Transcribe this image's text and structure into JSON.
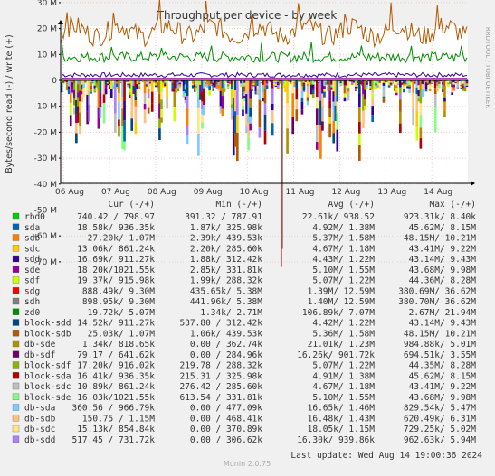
{
  "chart_data": {
    "type": "area",
    "title": "Throughput per device - by week",
    "ylabel": "Bytes/second read (-) / write (+)",
    "side_label": "RRDTOOL / TOBI OETIKER",
    "y_ticks": [
      "40 M",
      "30 M",
      "20 M",
      "10 M",
      "0",
      "-10 M",
      "-20 M",
      "-30 M",
      "-40 M",
      "-50 M",
      "-60 M",
      "-70 M"
    ],
    "y_tick_values": [
      40,
      30,
      20,
      10,
      0,
      -10,
      -20,
      -30,
      -40,
      -50,
      -60,
      -70
    ],
    "ylim": [
      -75,
      42
    ],
    "x_ticks": [
      "06 Aug",
      "07 Aug",
      "08 Aug",
      "09 Aug",
      "10 Aug",
      "11 Aug",
      "12 Aug",
      "13 Aug",
      "14 Aug"
    ],
    "grid": true,
    "columns": [
      "Cur (-/+)",
      "Min (-/+)",
      "Avg (-/+)",
      "Max (-/+)"
    ],
    "series": [
      {
        "name": "rbd0",
        "color": "#00cc00",
        "cur": "740.42 / 798.97",
        "min": "391.32 / 787.91",
        "avg": "22.61k/ 938.52",
        "max": "923.31k/   8.40k"
      },
      {
        "name": "sda",
        "color": "#0066b3",
        "cur": "18.58k/ 936.35k",
        "min": "1.87k/ 325.98k",
        "avg": "4.92M/   1.38M",
        "max": "45.62M/   8.15M"
      },
      {
        "name": "sdb",
        "color": "#ff8000",
        "cur": "27.20k/   1.07M",
        "min": "2.39k/ 439.53k",
        "avg": "5.37M/   1.58M",
        "max": "48.15M/  10.21M"
      },
      {
        "name": "sdc",
        "color": "#ffcc00",
        "cur": "13.06k/ 861.24k",
        "min": "2.20k/ 285.60k",
        "avg": "4.67M/   1.18M",
        "max": "43.41M/   9.22M"
      },
      {
        "name": "sdd",
        "color": "#330099",
        "cur": "16.69k/ 911.27k",
        "min": "1.88k/ 312.42k",
        "avg": "4.43M/   1.22M",
        "max": "43.14M/   9.43M"
      },
      {
        "name": "sde",
        "color": "#990099",
        "cur": "18.20k/1021.55k",
        "min": "2.85k/ 331.81k",
        "avg": "5.10M/   1.55M",
        "max": "43.68M/   9.98M"
      },
      {
        "name": "sdf",
        "color": "#ccff00",
        "cur": "19.37k/ 915.98k",
        "min": "1.99k/ 288.32k",
        "avg": "5.07M/   1.22M",
        "max": "44.36M/   8.28M"
      },
      {
        "name": "sdg",
        "color": "#ff0000",
        "cur": "888.49k/   9.30M",
        "min": "435.65k/   5.38M",
        "avg": "1.39M/  12.59M",
        "max": "380.69M/  36.62M"
      },
      {
        "name": "sdh",
        "color": "#808080",
        "cur": "898.95k/   9.30M",
        "min": "441.96k/   5.38M",
        "avg": "1.40M/  12.59M",
        "max": "380.70M/  36.62M"
      },
      {
        "name": "zd0",
        "color": "#008f00",
        "cur": "19.72k/   5.07M",
        "min": "1.34k/   2.71M",
        "avg": "106.89k/   7.07M",
        "max": "2.67M/  21.94M"
      },
      {
        "name": "block-sdd",
        "color": "#00487d",
        "cur": "14.52k/ 911.27k",
        "min": "537.80 / 312.42k",
        "avg": "4.42M/   1.22M",
        "max": "43.14M/   9.43M"
      },
      {
        "name": "block-sdb",
        "color": "#b35a00",
        "cur": "25.03k/   1.07M",
        "min": "1.06k/ 439.53k",
        "avg": "5.36M/   1.58M",
        "max": "48.15M/  10.21M"
      },
      {
        "name": "db-sde",
        "color": "#b38f00",
        "cur": "1.34k/ 818.65k",
        "min": "0.00 / 362.74k",
        "avg": "21.01k/   1.23M",
        "max": "984.88k/   5.01M"
      },
      {
        "name": "db-sdf",
        "color": "#6b006b",
        "cur": "79.17 / 641.62k",
        "min": "0.00 / 284.96k",
        "avg": "16.26k/ 901.72k",
        "max": "694.51k/   3.55M"
      },
      {
        "name": "block-sdf",
        "color": "#8fb300",
        "cur": "17.20k/ 916.02k",
        "min": "219.78 / 288.32k",
        "avg": "5.07M/   1.22M",
        "max": "44.35M/   8.28M"
      },
      {
        "name": "block-sda",
        "color": "#b30000",
        "cur": "16.41k/ 936.35k",
        "min": "215.31 / 325.98k",
        "avg": "4.91M/   1.38M",
        "max": "45.62M/   8.15M"
      },
      {
        "name": "block-sdc",
        "color": "#bebebe",
        "cur": "10.89k/ 861.24k",
        "min": "276.42 / 285.60k",
        "avg": "4.67M/   1.18M",
        "max": "43.41M/   9.22M"
      },
      {
        "name": "block-sde",
        "color": "#80ff80",
        "cur": "16.03k/1021.55k",
        "min": "613.54 / 331.81k",
        "avg": "5.10M/   1.55M",
        "max": "43.68M/   9.98M"
      },
      {
        "name": "db-sda",
        "color": "#80c9ff",
        "cur": "360.56 / 966.79k",
        "min": "0.00 / 477.09k",
        "avg": "16.65k/   1.46M",
        "max": "829.54k/   5.47M"
      },
      {
        "name": "db-sdb",
        "color": "#ffc080",
        "cur": "150.75 /   1.15M",
        "min": "0.00 / 468.41k",
        "avg": "16.48k/   1.43M",
        "max": "620.49k/   6.31M"
      },
      {
        "name": "db-sdc",
        "color": "#ffe680",
        "cur": "15.13k/ 854.84k",
        "min": "0.00 / 370.89k",
        "avg": "18.05k/   1.15M",
        "max": "729.25k/   5.02M"
      },
      {
        "name": "db-sdd",
        "color": "#aa80ff",
        "cur": "517.45 / 731.72k",
        "min": "0.00 / 306.62k",
        "avg": "16.30k/ 939.86k",
        "max": "962.63k/   5.94M"
      }
    ]
  },
  "footer": {
    "version": "Munin 2.0.75",
    "last_update": "Last update:  Wed Aug 14 19:00:36 2024"
  }
}
